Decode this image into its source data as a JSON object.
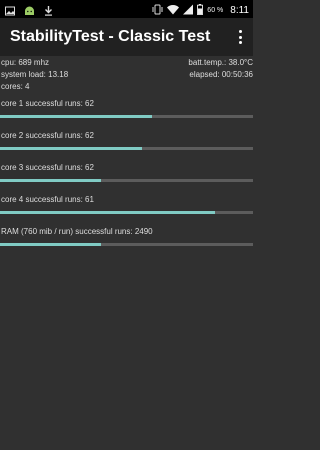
{
  "status_bar": {
    "icons_left": [
      "gallery-icon",
      "android-icon",
      "download-icon"
    ],
    "icons_right": [
      "vibrate-icon",
      "wifi-icon",
      "signal-icon",
      "battery-icon"
    ],
    "battery_text": "60 %",
    "time": "8:11"
  },
  "app_bar": {
    "title": "StabilityTest - Classic Test",
    "overflow_icon": "more-vert-icon"
  },
  "info": {
    "cpu": "cpu: 689 mhz",
    "batt_temp": "batt.temp.: 38.0°C",
    "system_load": "system load: 13.18",
    "elapsed": "elapsed: 00:50:36",
    "cores": "cores: 4"
  },
  "tests": [
    {
      "label": "core 1 successful runs: 62",
      "progress": 0.6
    },
    {
      "label": "core 2 successful runs: 62",
      "progress": 0.56
    },
    {
      "label": "core 3 successful runs: 62",
      "progress": 0.4
    },
    {
      "label": "core 4 successful runs: 61",
      "progress": 0.85
    },
    {
      "label": "RAM (760 mib / run) successful runs: 2490",
      "progress": 0.4
    }
  ],
  "colors": {
    "accent": "#80cbc4",
    "track": "#5c5c5c",
    "background": "#303030",
    "app_bar": "#212121"
  }
}
